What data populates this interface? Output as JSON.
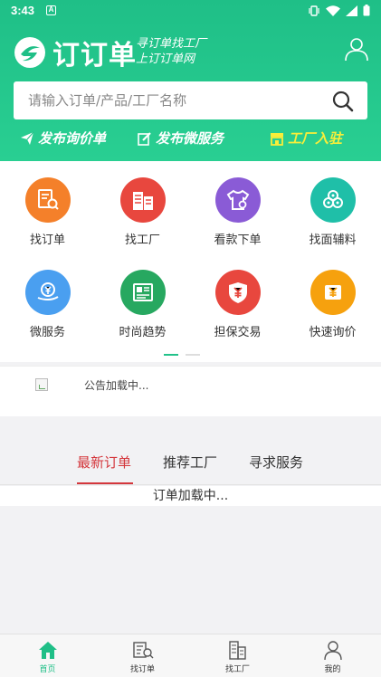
{
  "status_bar": {
    "time": "3:43",
    "notification_letter": "A"
  },
  "header": {
    "brand_name": "订订单",
    "slogan_line1": "寻订单找工厂",
    "slogan_line2": "上订订单网",
    "icons": {
      "logo": "brand-logo-icon",
      "user": "user-icon"
    }
  },
  "search": {
    "placeholder": "请输入订单/产品/工厂名称",
    "value": "",
    "icon": "search-icon"
  },
  "quick_actions": [
    {
      "label": "发布询价单",
      "icon": "paper-plane-icon"
    },
    {
      "label": "发布微服务",
      "icon": "edit-icon"
    },
    {
      "label": "工厂入驻",
      "icon": "store-icon"
    }
  ],
  "categories": [
    {
      "label": "找订单",
      "icon": "order-search-icon",
      "color": "#f4802a"
    },
    {
      "label": "找工厂",
      "icon": "factory-icon",
      "color": "#e8473e"
    },
    {
      "label": "看款下单",
      "icon": "shirt-icon",
      "color": "#8a5bd6"
    },
    {
      "label": "找面辅料",
      "icon": "fabric-rolls-icon",
      "color": "#1fbfa8"
    },
    {
      "label": "微服务",
      "icon": "yuan-hand-icon",
      "color": "#4a9ff0"
    },
    {
      "label": "时尚趋势",
      "icon": "news-icon",
      "color": "#27a860"
    },
    {
      "label": "担保交易",
      "icon": "shield-yuan-icon",
      "color": "#e8473e"
    },
    {
      "label": "快速询价",
      "icon": "price-tag-icon",
      "color": "#f6a10e"
    }
  ],
  "notice": {
    "text": "公告加载中..."
  },
  "tabs": [
    {
      "label": "最新订单",
      "active": true
    },
    {
      "label": "推荐工厂",
      "active": false
    },
    {
      "label": "寻求服务",
      "active": false
    }
  ],
  "list_status": "订单加载中...",
  "bottom_nav": [
    {
      "label": "首页",
      "icon": "home-icon",
      "active": true
    },
    {
      "label": "找订单",
      "icon": "order-search-icon",
      "active": false
    },
    {
      "label": "找工厂",
      "icon": "factory-icon",
      "active": false
    },
    {
      "label": "我的",
      "icon": "user-icon",
      "active": false
    }
  ],
  "colors": {
    "brand_green": "#1fbf87",
    "accent_red": "#d4373c",
    "highlight_yellow": "#f8ee3a"
  }
}
